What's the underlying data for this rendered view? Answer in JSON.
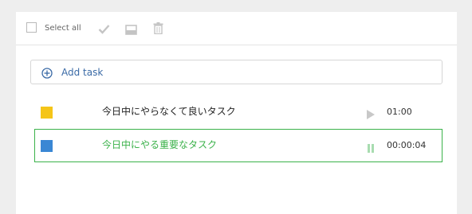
{
  "toolbar": {
    "select_all_label": "Select all",
    "icons": [
      "check-icon",
      "archive-icon",
      "trash-icon"
    ]
  },
  "add_task": {
    "label": "Add task",
    "icon": "plus-circle-icon"
  },
  "tasks": [
    {
      "title": "今日中にやらなくて良いタスク",
      "time": "01:00",
      "color": "#f5c518",
      "control": "play-icon",
      "running": false
    },
    {
      "title": "今日中にやる重要なタスク",
      "time": "00:00:04",
      "color": "#3a87d4",
      "control": "pause-icon",
      "running": true
    }
  ],
  "colors": {
    "accent": "#3bb24a",
    "link": "#3a6aa6"
  }
}
